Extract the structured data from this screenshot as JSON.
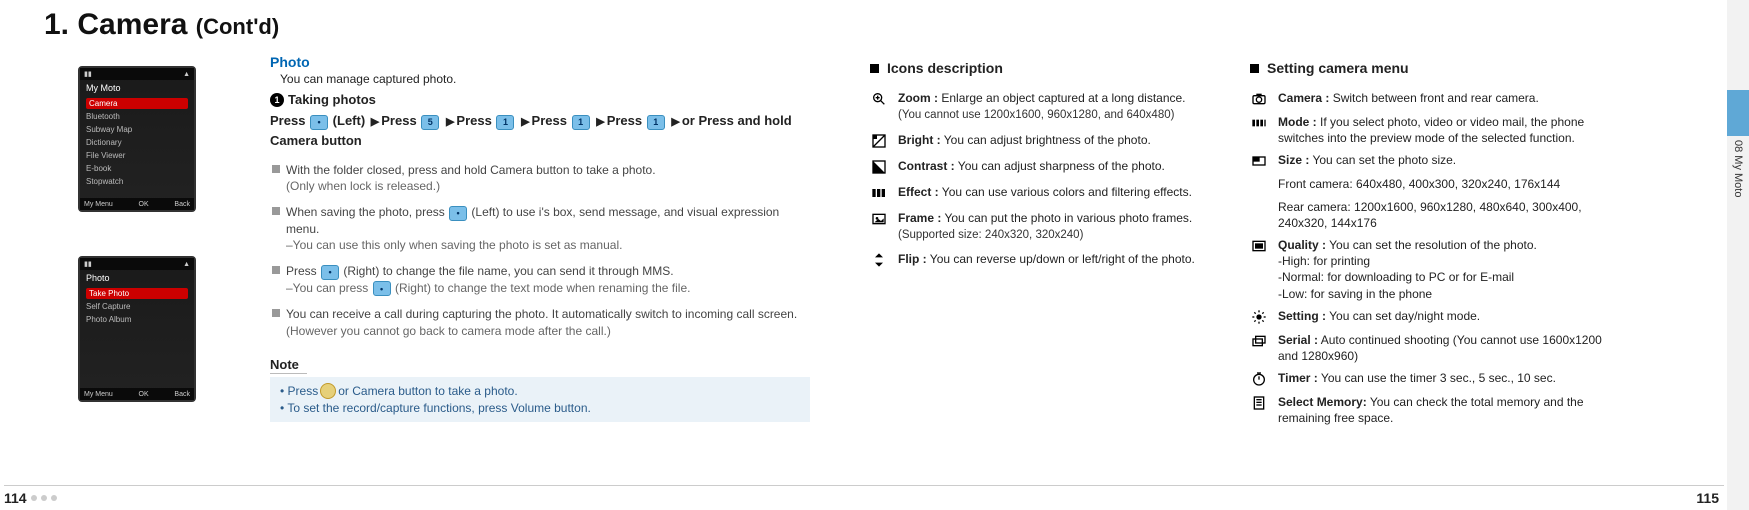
{
  "title_main": "1. Camera",
  "title_sub": "(Cont'd)",
  "screenshots": {
    "a": {
      "title": "My Moto",
      "highlight": "Camera",
      "rows": [
        "Bluetooth",
        "Subway Map",
        "Dictionary",
        "File Viewer",
        "E-book",
        "Stopwatch"
      ],
      "sk_left": "My Menu",
      "sk_mid": "OK",
      "sk_right": "Back"
    },
    "b": {
      "title": "Photo",
      "highlight": "Take Photo",
      "rows": [
        "Self Capture",
        "Photo Album"
      ],
      "sk_left": "My Menu",
      "sk_mid": "OK",
      "sk_right": "Back"
    }
  },
  "photo": {
    "section_title": "Photo",
    "intro": "You can manage captured photo.",
    "step_num": "1",
    "step_title": "Taking photos",
    "press_a": "Press",
    "press_left": "(Left)",
    "press_seq": "Press",
    "press_tail": "or Press and hold Camera button",
    "bullets": [
      {
        "main": "With the folder closed, press and hold Camera button to take a photo.",
        "sub": "(Only when lock is released.)"
      },
      {
        "main": "When saving the photo, press ",
        "inline_key": true,
        "main_after": " (Left) to use i's box, send message, and visual expression menu.",
        "sub": "–You can use this only when saving the photo is set as manual."
      },
      {
        "main": "Press ",
        "inline_key": true,
        "main_after": " (Right) to change the file name, you can send it through MMS.",
        "sub": "–You can press ",
        "sub_inline_key": true,
        "sub_after": " (Right) to change the text mode when renaming the file."
      },
      {
        "main": "You can receive a call during capturing the photo. It automatically switch to incoming call screen.",
        "sub": "(However you cannot go back to camera mode after the call.)"
      }
    ],
    "note_title": "Note",
    "note_lines": [
      "• Press ",
      " or Camera button to take a photo.",
      "• To set the record/capture functions, press Volume button."
    ]
  },
  "icons": {
    "title": "Icons description",
    "rows": [
      {
        "icon": "zoom",
        "label": "Zoom :",
        "desc": "Enlarge an object captured at a long distance.",
        "extra": "(You cannot use 1200x1600, 960x1280, and 640x480)"
      },
      {
        "icon": "bright",
        "label": "Bright :",
        "desc": "You can adjust brightness of the photo."
      },
      {
        "icon": "contrast",
        "label": "Contrast :",
        "desc": "You can adjust sharpness of the photo."
      },
      {
        "icon": "effect",
        "label": "Effect :",
        "desc": "You can use various colors and filtering effects."
      },
      {
        "icon": "frame",
        "label": "Frame :",
        "desc": "You can put the photo in various photo frames.",
        "extra": "(Supported size: 240x320, 320x240)"
      },
      {
        "icon": "flip",
        "label": "Flip :",
        "desc": "You can reverse up/down or left/right of the photo."
      }
    ]
  },
  "settings": {
    "title": "Setting camera menu",
    "rows": [
      {
        "icon": "camera",
        "label": "Camera  :",
        "desc": "Switch between front and rear camera."
      },
      {
        "icon": "mode",
        "label": "Mode :",
        "desc": "If you select photo, video or video mail, the phone switches into the preview mode of the selected function."
      },
      {
        "icon": "size",
        "label": "Size :",
        "desc": "You can set the photo size.",
        "lines": [
          "Front camera: 640x480, 400x300, 320x240, 176x144",
          "Rear camera: 1200x1600, 960x1280, 480x640, 300x400, 240x320, 144x176"
        ]
      },
      {
        "icon": "quality",
        "label": "Quality :",
        "desc": "You can set the resolution of the photo.",
        "lines": [
          "-High: for printing",
          "-Normal: for downloading to PC or for E-mail",
          "-Low: for saving in the phone"
        ]
      },
      {
        "icon": "setting",
        "label": "Setting :",
        "desc": "You can set day/night mode."
      },
      {
        "icon": "serial",
        "label": "Serial :",
        "desc": "Auto continued shooting (You cannot use 1600x1200 and 1280x960)"
      },
      {
        "icon": "timer",
        "label": "Timer :",
        "desc": "You can use the timer 3 sec., 5 sec., 10 sec."
      },
      {
        "icon": "memory",
        "label": "Select Memory:",
        "desc": "You can check the total memory and the remaining free space."
      }
    ]
  },
  "side_tab": "08  My Moto",
  "page_left": "114",
  "page_right": "115"
}
